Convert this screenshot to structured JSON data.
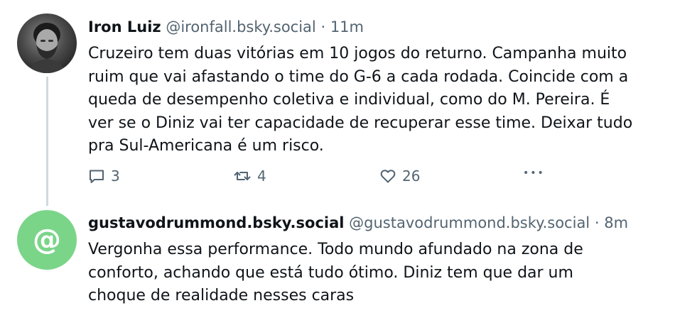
{
  "posts": [
    {
      "author": "Iron Luiz",
      "handle": "@ironfall.bsky.social",
      "separator": "·",
      "time": "11m",
      "text_lines": [
        "Cruzeiro tem duas vitórias em 10 jogos do returno. Campanha muito",
        "ruim que vai afastando o time do G-6 a cada rodada. Coincide com a",
        "queda de desempenho coletiva e individual, como do M. Pereira. É",
        "ver se o Diniz vai ter capacidade de recuperar esse time. Deixar tudo",
        "pra Sul-Americana é um risco."
      ],
      "replies": "3",
      "reposts": "4",
      "likes": "26",
      "more": "•••"
    },
    {
      "author": "gustavodrummond.bsky.social",
      "handle": "@gustavodrummond.bsky.social",
      "separator": "·",
      "time": "8m",
      "avatar_symbol": "@",
      "text_lines": [
        "Vergonha essa performance. Todo mundo afundado na zona de",
        "conforto, achando que está tudo ótimo. Diniz tem que dar um",
        "choque de realidade nesses caras"
      ]
    }
  ],
  "icons": {
    "reply": "speech-bubble-icon",
    "repost": "repost-arrows-icon",
    "like": "heart-icon",
    "more": "ellipsis-icon"
  },
  "colors": {
    "text": "#0f1419",
    "muted": "#536471",
    "thread_line": "#cfd9de",
    "default_avatar": "#7ad589"
  }
}
